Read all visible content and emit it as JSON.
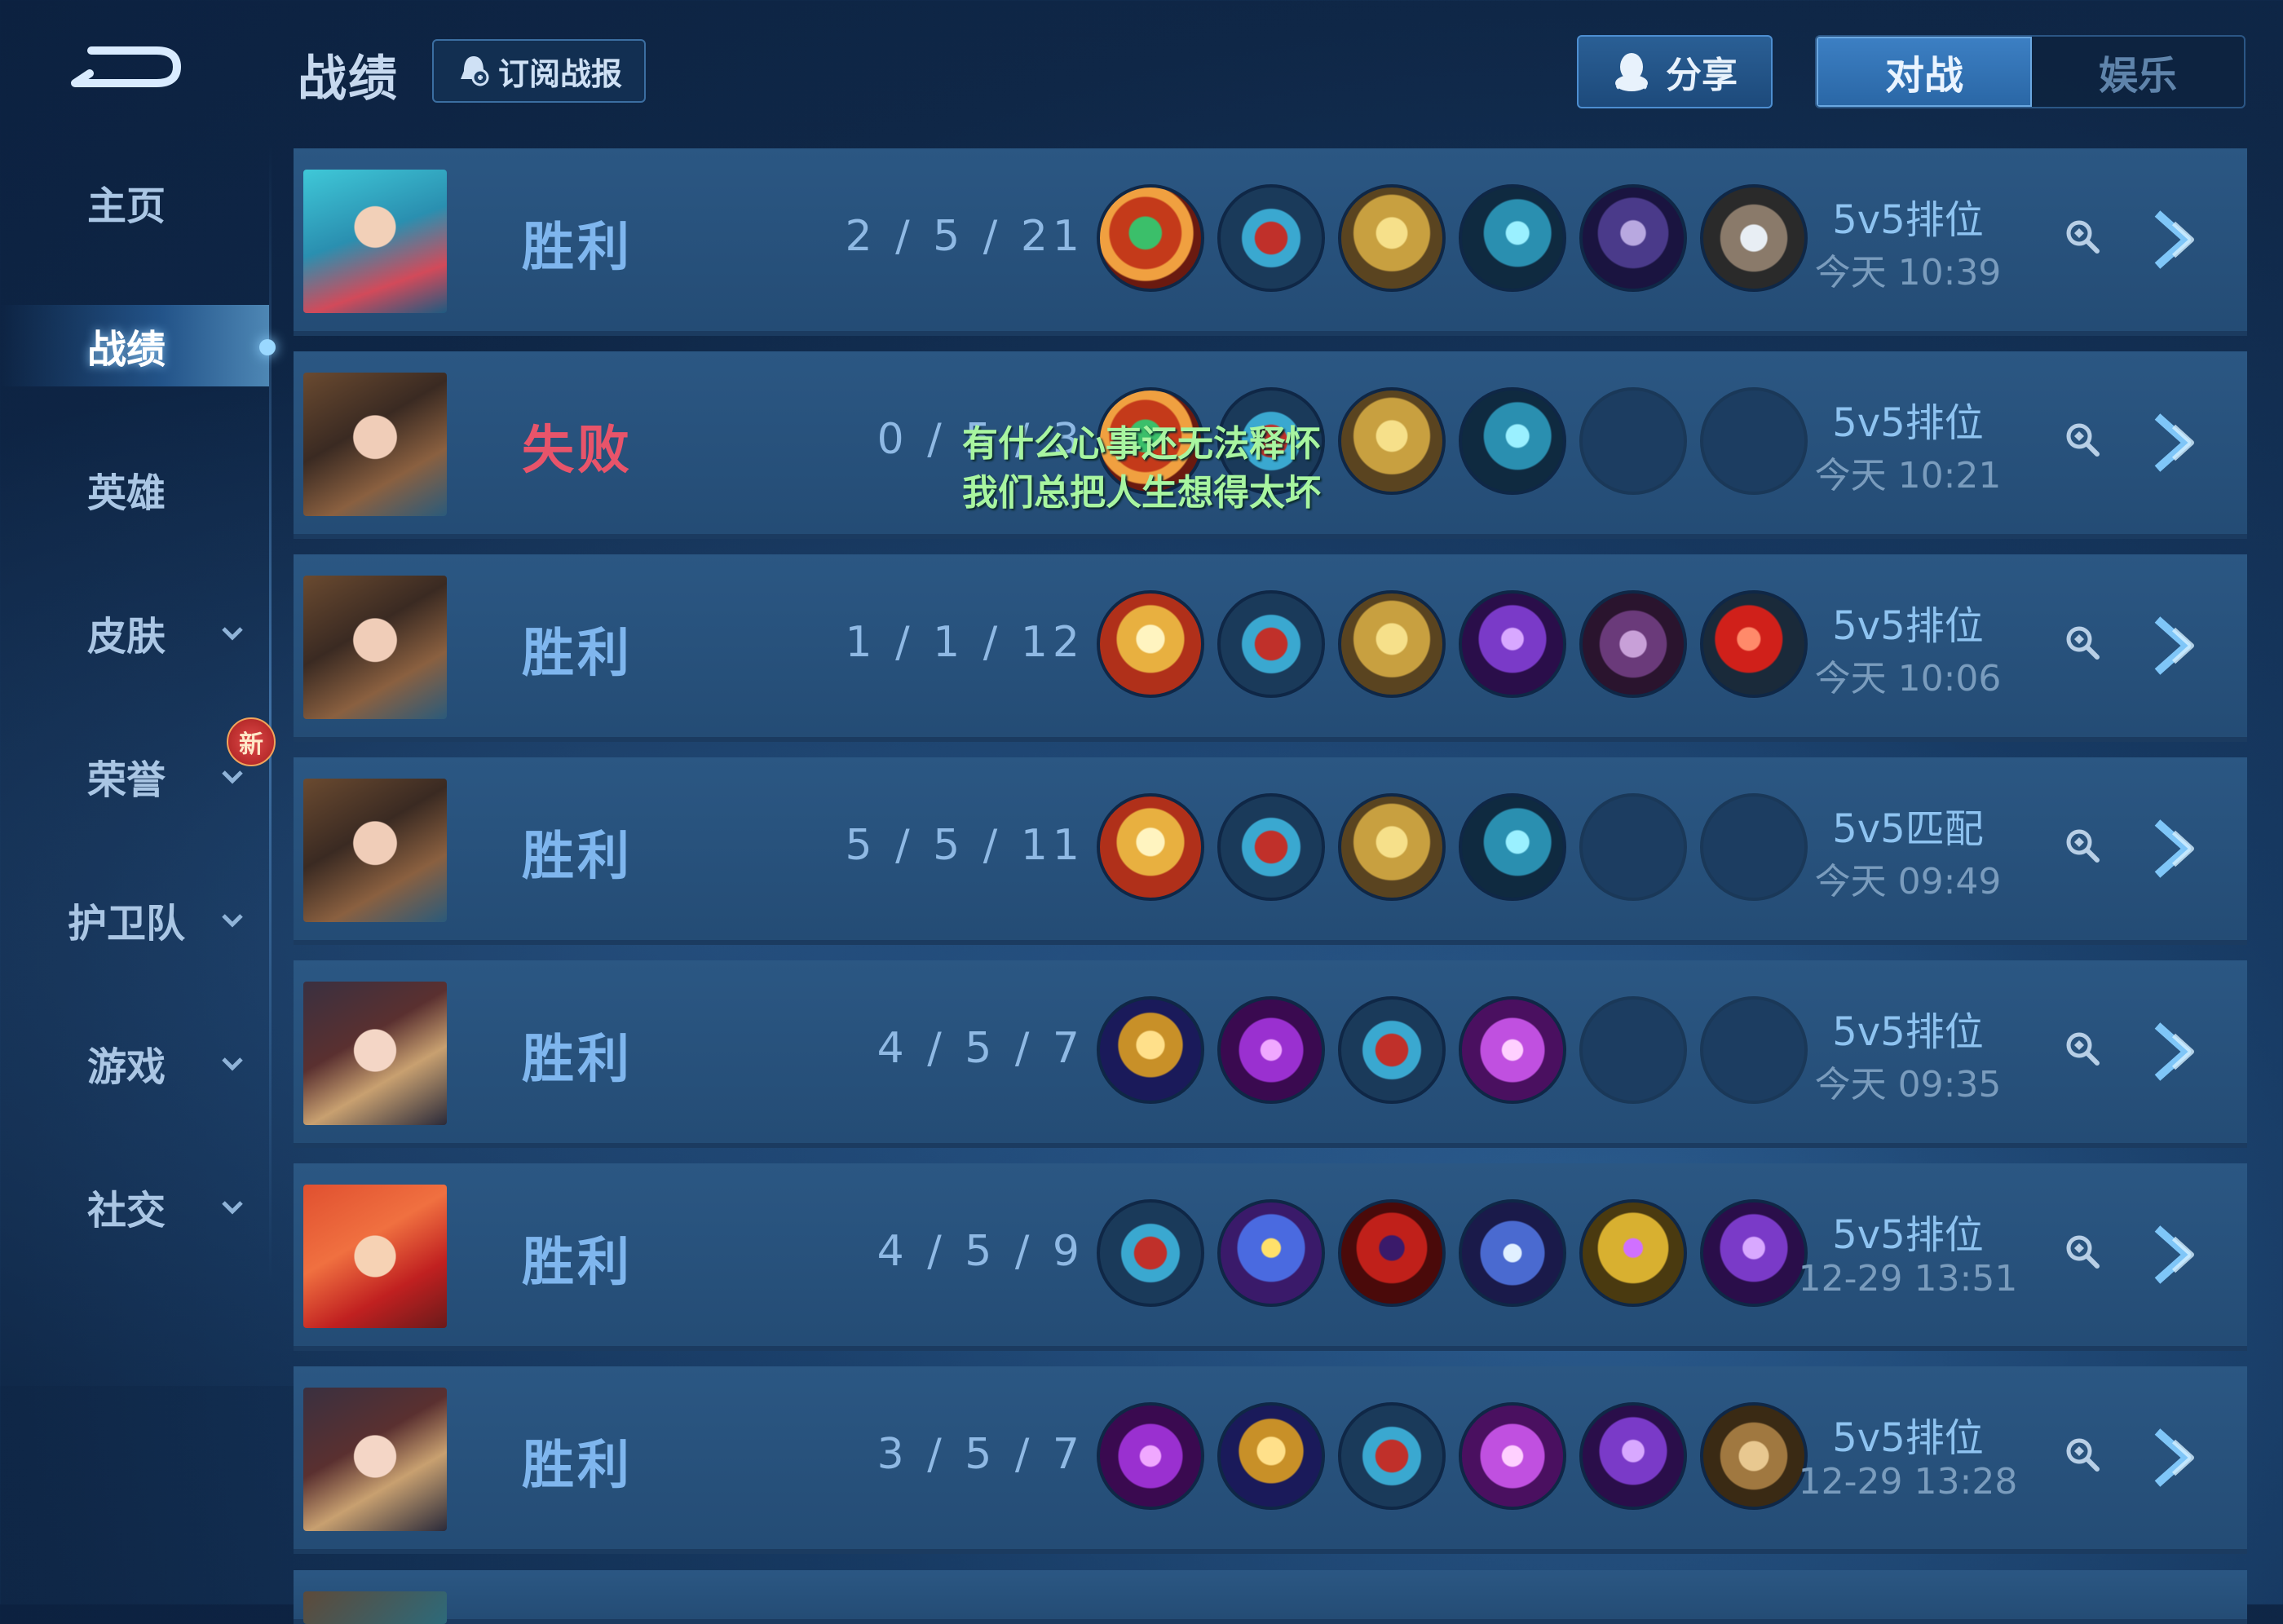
{
  "header": {
    "title": "战绩",
    "subscribe_label": "订阅战报",
    "share_label": "分享",
    "tabs": [
      {
        "label": "对战",
        "active": true
      },
      {
        "label": "娱乐",
        "active": false
      }
    ]
  },
  "sidebar": {
    "items": [
      {
        "label": "主页",
        "chevron": false,
        "active": false
      },
      {
        "label": "战绩",
        "chevron": false,
        "active": true
      },
      {
        "label": "英雄",
        "chevron": false,
        "active": false
      },
      {
        "label": "皮肤",
        "chevron": true,
        "active": false
      },
      {
        "label": "荣誉",
        "chevron": true,
        "active": false
      },
      {
        "label": "护卫队",
        "chevron": true,
        "active": false
      },
      {
        "label": "游戏",
        "chevron": true,
        "active": false
      },
      {
        "label": "社交",
        "chevron": true,
        "active": false
      }
    ],
    "new_badge": "新"
  },
  "lyrics": {
    "line1": "有什么心事还无法释怀",
    "line2": "我们总把人生想得太坏"
  },
  "matches": [
    {
      "result": "胜利",
      "kda": "2 / 5 / 21",
      "mode": "5v5排位",
      "time": "今天 10:39",
      "hero": "hero-mermaid",
      "items": [
        "jade-dragon-item",
        "red-boots-item",
        "golden-mask-item",
        "cyan-scythe-item",
        "dark-armor-item",
        "silver-shield-item"
      ]
    },
    {
      "result": "失败",
      "kda": "0 / 5 / 3",
      "mode": "5v5排位",
      "time": "今天 10:21",
      "hero": "hero-brunette",
      "items": [
        "jade-dragon-item",
        "red-boots-item",
        "golden-mask-item",
        "cyan-scythe-item",
        "empty",
        "empty"
      ]
    },
    {
      "result": "胜利",
      "kda": "1 / 1 / 12",
      "mode": "5v5排位",
      "time": "今天 10:06",
      "hero": "hero-brunette",
      "items": [
        "golden-feather-item",
        "red-boots-item",
        "golden-mask-item",
        "purple-staff-item",
        "purple-book-item",
        "red-gem-item"
      ]
    },
    {
      "result": "胜利",
      "kda": "5 / 5 / 11",
      "mode": "5v5匹配",
      "time": "今天 09:49",
      "hero": "hero-brunette",
      "items": [
        "golden-feather-item",
        "red-boots-item",
        "golden-mask-item",
        "cyan-scythe-item",
        "empty",
        "empty"
      ]
    },
    {
      "result": "胜利",
      "kda": "4 / 5 / 7",
      "mode": "5v5排位",
      "time": "今天 09:35",
      "hero": "hero-priestess",
      "items": [
        "golden-chalice-item",
        "violet-dagger-item",
        "red-boots-item",
        "violet-cloak-item",
        "empty",
        "empty"
      ]
    },
    {
      "result": "胜利",
      "kda": "4 / 5 / 9",
      "mode": "5v5排位",
      "time": "12-29  13:51",
      "hero": "hero-redhair",
      "items": [
        "red-boots-item",
        "blue-phoenix-item",
        "crimson-hood-item",
        "blue-sword-item",
        "golden-wand-item",
        "purple-staff-item"
      ]
    },
    {
      "result": "胜利",
      "kda": "3 / 5 / 7",
      "mode": "5v5排位",
      "time": "12-29  13:28",
      "hero": "hero-priestess",
      "items": [
        "violet-dagger-item",
        "golden-chalice-item",
        "red-boots-item",
        "violet-cloak-item",
        "purple-staff-item",
        "wooden-tome-item"
      ]
    }
  ],
  "colors": {
    "win": "#7fb6ee",
    "loss": "#e8546a",
    "accent": "#3c7fc3"
  }
}
